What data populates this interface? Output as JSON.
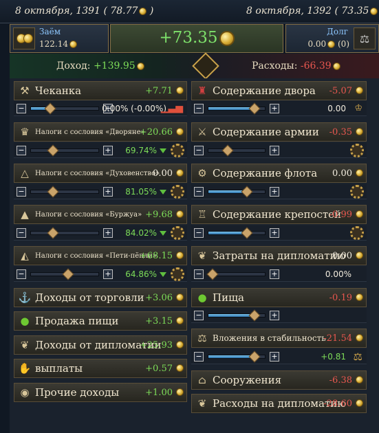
{
  "header": {
    "date_left": "8 октября, 1391 ( 78.77",
    "date_left_close": ")",
    "date_right": "8 октября, 1392 ( 73.35",
    "date_right_close": ")"
  },
  "loan": {
    "label": "Заём",
    "value": "122.14"
  },
  "balance": {
    "value": "+73.35"
  },
  "debt": {
    "label": "Долг",
    "value": "0.00",
    "count": "(0)"
  },
  "summary": {
    "income_label": "Доход:",
    "income_value": "+139.95",
    "expense_label": "Расходы:",
    "expense_value": "-66.39"
  },
  "income": [
    {
      "label": "Чеканка",
      "value": "+7.71",
      "icon": "hammer-icon"
    },
    {
      "label": "Налоги с сословия «Дворяне»",
      "value": "+20.66",
      "icon": "nobles-icon"
    },
    {
      "label": "Налоги с сословия «Духовенство»",
      "value": "0.00",
      "icon": "clergy-icon"
    },
    {
      "label": "Налоги с сословия «Буржуа»",
      "value": "+9.68",
      "icon": "burghers-icon"
    },
    {
      "label": "Налоги с сословия «Пети-пёпли»",
      "value": "+68.15",
      "icon": "peasants-icon"
    },
    {
      "label": "Доходы от торговли",
      "value": "+3.06",
      "icon": "trade-icon"
    },
    {
      "label": "Продажа пищи",
      "value": "+3.15",
      "icon": "apple-icon"
    },
    {
      "label": "Доходы от дипломатии",
      "value": "+25.93",
      "icon": "dove-icon"
    },
    {
      "label": "выплаты",
      "value": "+0.57",
      "icon": "payment-icon"
    },
    {
      "label": "Прочие доходы",
      "value": "+1.00",
      "icon": "coins-icon"
    }
  ],
  "income_controls": [
    {
      "pct": "0.00% (-0.00%)",
      "level": 0.25
    },
    {
      "pct": "69.74%",
      "level": 0.3
    },
    {
      "pct": "81.05%",
      "level": 0.3
    },
    {
      "pct": "84.02%",
      "level": 0.3
    },
    {
      "pct": "64.86%",
      "level": 0.55
    }
  ],
  "expenses": [
    {
      "label": "Содержание двора",
      "value": "-5.07",
      "icon": "court-icon"
    },
    {
      "label": "Содержание армии",
      "value": "-0.35",
      "icon": "army-icon"
    },
    {
      "label": "Содержание флота",
      "value": "0.00",
      "icon": "fleet-icon"
    },
    {
      "label": "Содержание крепостей",
      "value": "-0.99",
      "icon": "fortress-icon"
    },
    {
      "label": "Затраты на дипломатию",
      "value": "0.00",
      "icon": "dove-icon"
    },
    {
      "label": "Пища",
      "value": "-0.19",
      "icon": "apple-icon"
    },
    {
      "label": "Вложения в стабильность",
      "value": "-21.54",
      "icon": "scales-icon"
    },
    {
      "label": "Сооружения",
      "value": "-6.38",
      "icon": "buildings-icon"
    },
    {
      "label": "Расходы на дипломатию",
      "value": "-28.60",
      "icon": "dove-icon"
    }
  ],
  "expense_controls": [
    {
      "level": 0.85,
      "extra": "0.00"
    },
    {
      "level": 0.3
    },
    {
      "level": 0.7
    },
    {
      "level": 0.7
    },
    {
      "level": 0.0,
      "extra": "0.00%"
    },
    {
      "level": 0.85
    },
    {
      "level": 0.85,
      "extra": "+0.81"
    }
  ]
}
